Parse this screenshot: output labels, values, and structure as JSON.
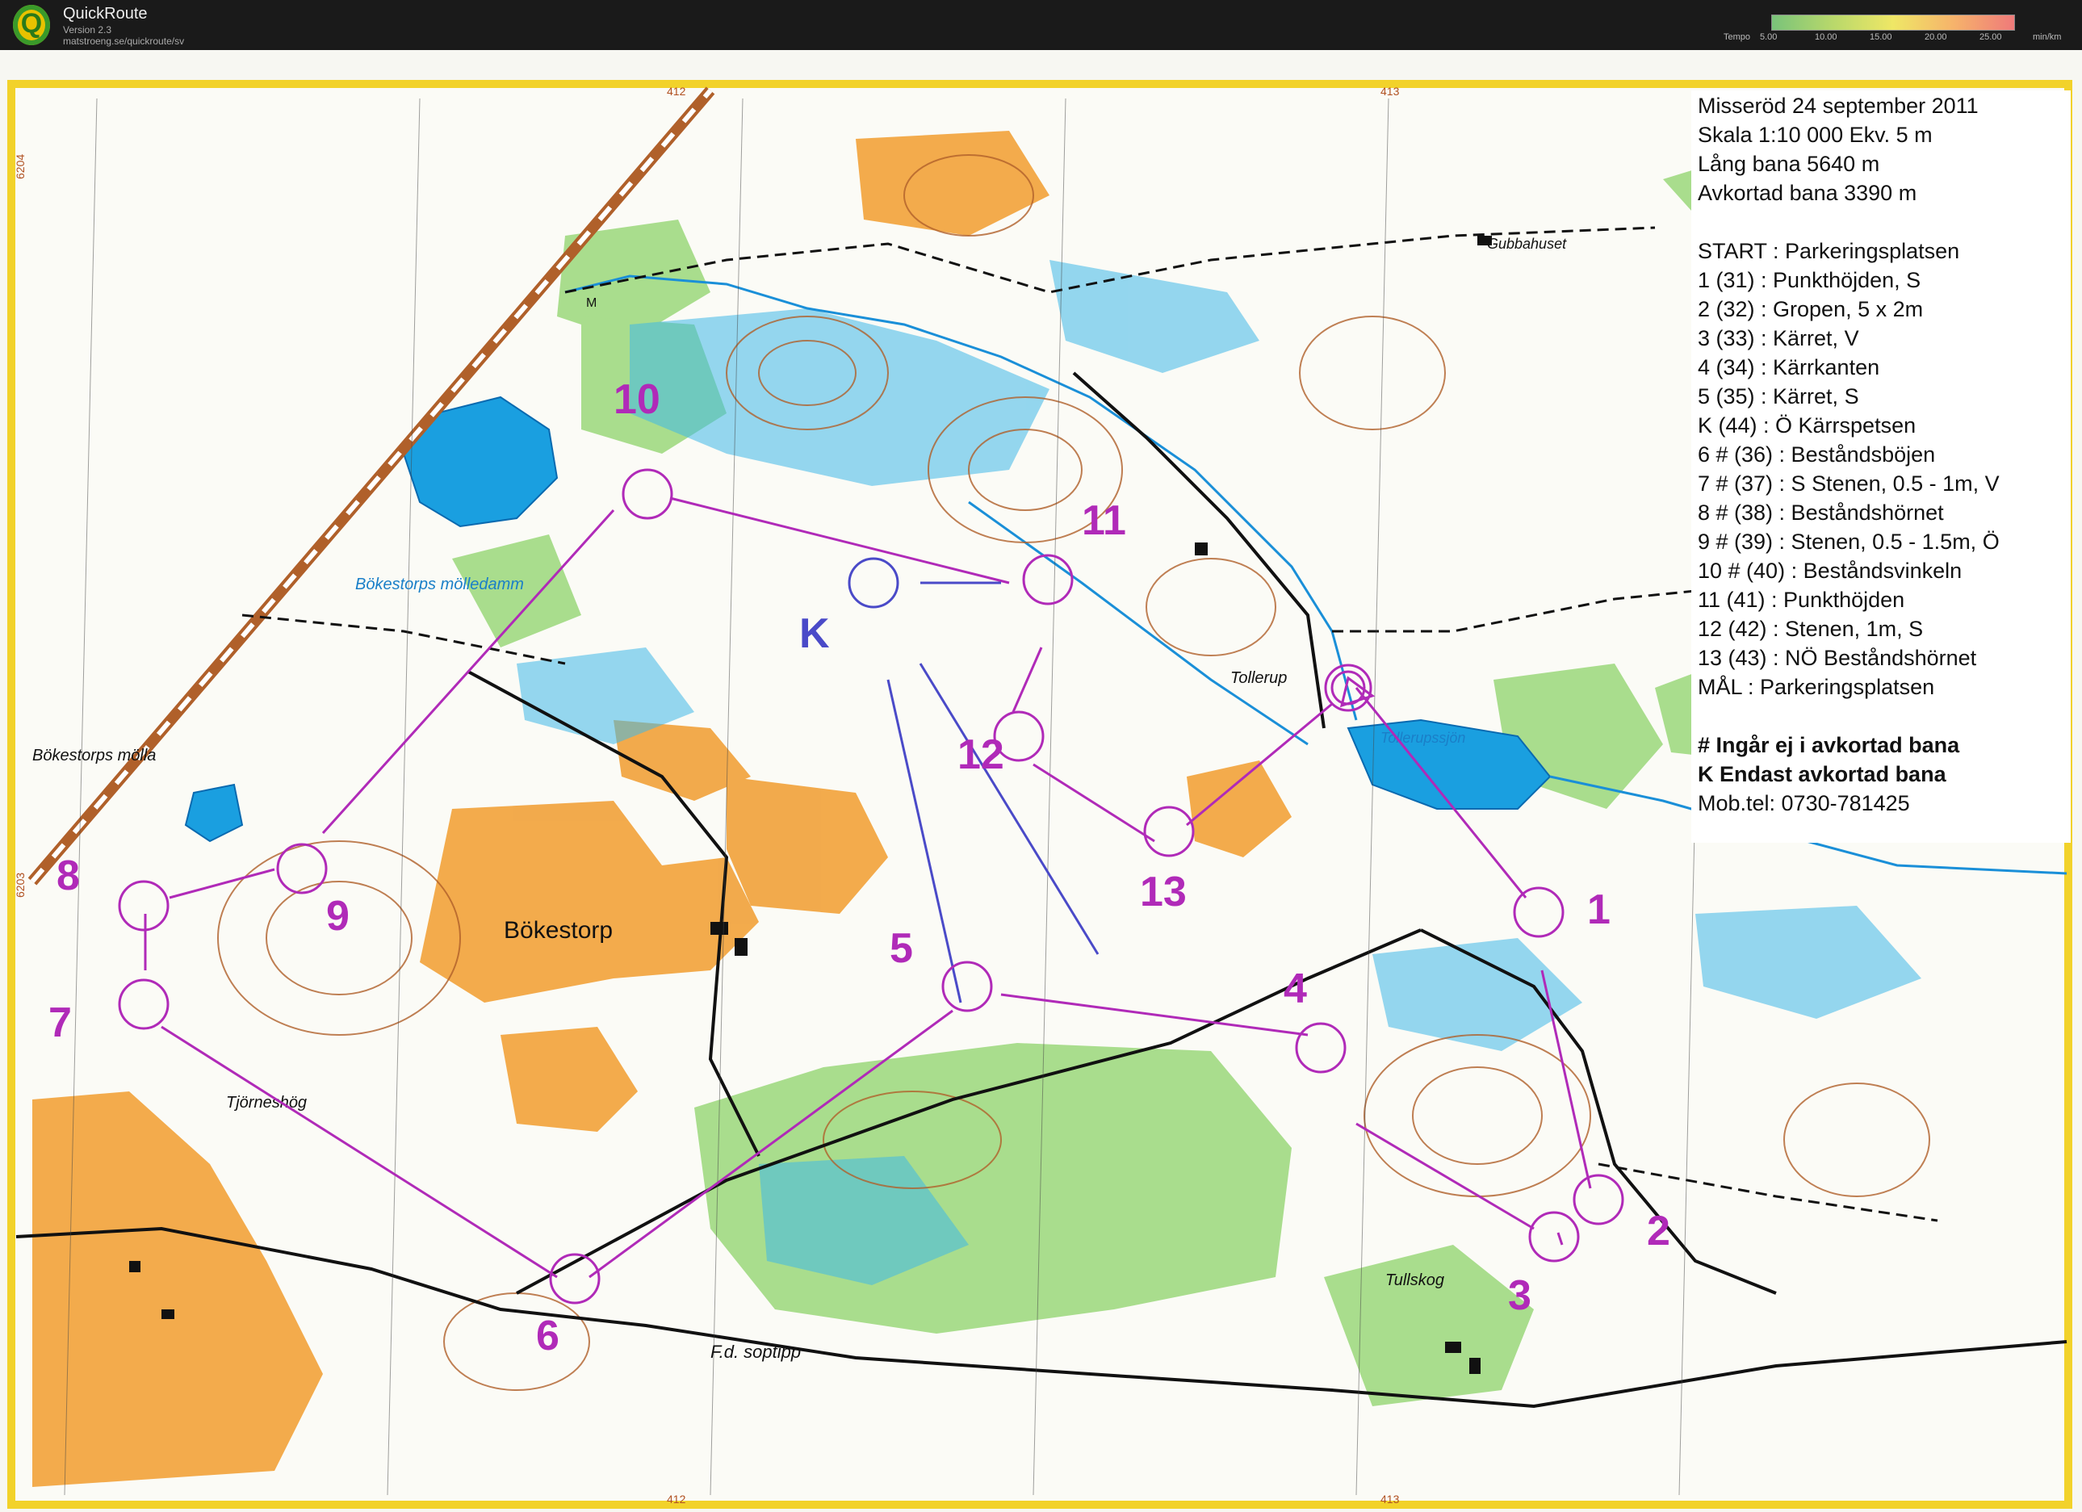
{
  "app": {
    "name": "QuickRoute",
    "version": "Version 2.3",
    "url": "matstroeng.se/quickroute/sv",
    "logo_letter": "Q"
  },
  "tempo_scale": {
    "label": "Tempo",
    "ticks": [
      "5.00",
      "10.00",
      "15.00",
      "20.00",
      "25.00"
    ],
    "unit": "min/km",
    "colors": [
      "#79c37a",
      "#b8d86b",
      "#efe766",
      "#f6b36b",
      "#ef7a7a"
    ]
  },
  "map": {
    "grid_labels": [
      "412",
      "413",
      "412",
      "413",
      "6204",
      "6203"
    ],
    "place_names": [
      "Bökestorps mölledamm",
      "Bökestorps möllа",
      "Bökestorp",
      "Tjörneshög",
      "F.d. soptipp",
      "Tullskog",
      "Tollerup",
      "Tollerupssjön",
      "Gubbahuset",
      "M",
      "K"
    ],
    "control_numbers": [
      "1",
      "2",
      "3",
      "4",
      "5",
      "6",
      "7",
      "8",
      "9",
      "10",
      "11",
      "12",
      "13",
      "K"
    ],
    "colors": {
      "course": "#b02ab8",
      "short_course": "#4a4ac8",
      "open_land": "#f2a23a",
      "forest_green": "#8ed36a",
      "marsh_blue": "#3fb8e8",
      "contour_brown": "#b0602a",
      "road": "#111111",
      "frame": "#f2d22a"
    }
  },
  "legend": {
    "lines": [
      "Misseröd 24 september 2011",
      "Skala  1:10 000   Ekv.  5 m",
      "Lång bana  5640 m",
      "Avkortad bana 3390 m",
      "",
      "START    : Parkeringsplatsen",
      "1       (31) : Punkthöjden, S",
      "2       (32) : Gropen, 5 x 2m",
      "3       (33) : Kärret, V",
      "4       (34) : Kärrkanten",
      "5       (35) : Kärret, S",
      "  K     (44) : Ö Kärrspetsen",
      "6 #    (36) : Beståndsböjen",
      "7 #    (37) : S Stenen, 0.5 - 1m, V",
      "8 #    (38) : Beståndshörnet",
      "9 #    (39) : Stenen, 0.5 - 1.5m, Ö",
      "10 # (40) : Beståndsvinkeln",
      "11     (41) : Punkthöjden",
      "12     (42) : Stenen, 1m, S",
      "13     (43) : NÖ Beståndshörnet",
      "MÅL     : Parkeringsplatsen",
      "",
      "# Ingår ej i avkortad bana",
      "K Endast avkortad bana",
      "Mob.tel: 0730-781425"
    ]
  }
}
